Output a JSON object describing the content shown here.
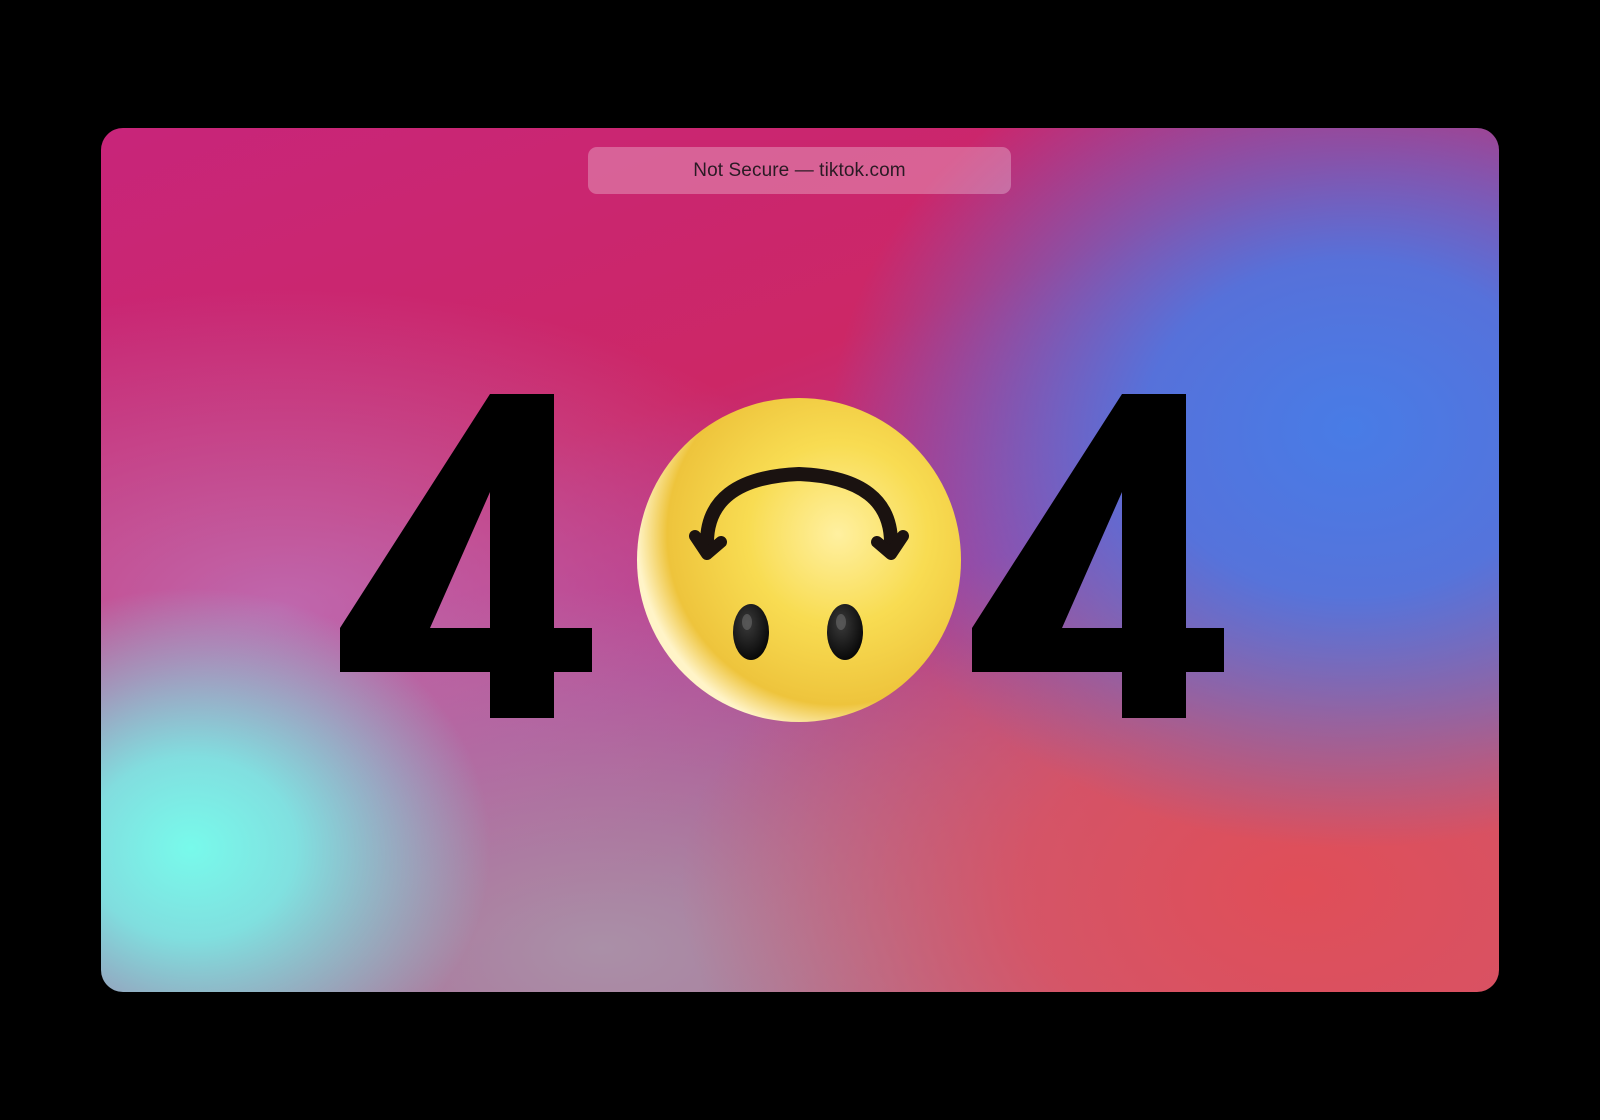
{
  "browser": {
    "address_bar": "Not Secure — tiktok.com"
  },
  "error_page": {
    "digit_left": "4",
    "digit_right": "4",
    "center_emoji": "upside-down-face-emoji",
    "digit_color": "#000000",
    "emoji_color": "#f7d84a"
  },
  "colors": {
    "frame_background": "#000000",
    "gradient_pink": "#cc2766",
    "gradient_blue": "#4b7ce4",
    "gradient_red": "#e04e58",
    "gradient_cyan": "#78faeb"
  }
}
